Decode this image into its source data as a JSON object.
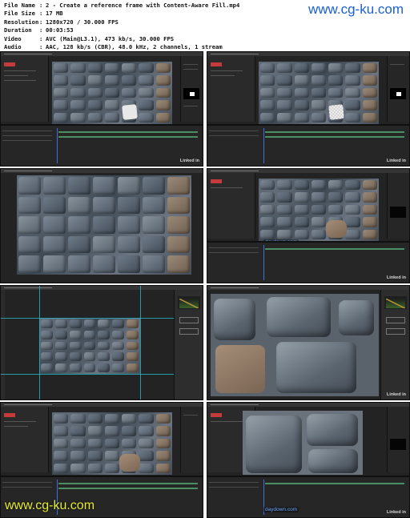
{
  "info": [
    {
      "key": "File Name",
      "value": "2 - Create a reference frame with Content-Aware Fill.mp4"
    },
    {
      "key": "File Size",
      "value": "17 MB"
    },
    {
      "key": "Resolution",
      "value": "1280x720 / 30.000 FPS"
    },
    {
      "key": "Duration",
      "value": "00:03:53"
    },
    {
      "key": "Video",
      "value": "AVC (Main@L3.1), 473 kb/s, 30.000 FPS"
    },
    {
      "key": "Audio",
      "value": "AAC, 128 kb/s (CBR), 48.0 kHz, 2 channels, 1 stream"
    }
  ],
  "separator": ":",
  "watermarks": {
    "top": "www.cg-ku.com",
    "bottom": "www.cg-ku.com",
    "daydown": "daydown.com"
  },
  "thumbs": {
    "linkedin": "Linked in"
  },
  "colors": {
    "watermark_blue": "#1a5fd6",
    "watermark_yellow": "#e9ee2a",
    "app_dark": "#232323",
    "timeline_green": "#4a8f63",
    "guide_cyan": "#22b8c9"
  }
}
